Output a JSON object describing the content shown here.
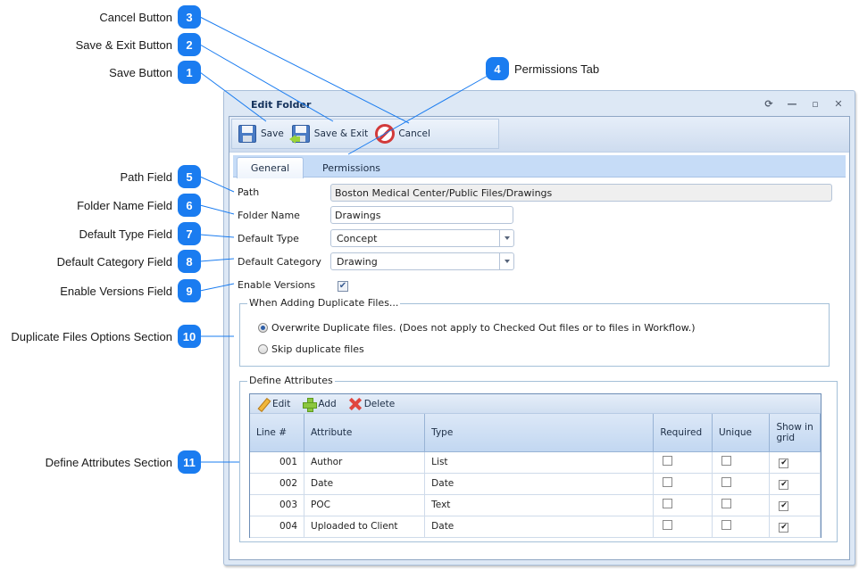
{
  "callouts": [
    {
      "n": "3",
      "label": "Cancel Button"
    },
    {
      "n": "2",
      "label": "Save & Exit Button"
    },
    {
      "n": "1",
      "label": "Save Button"
    },
    {
      "n": "4",
      "label": "Permissions Tab"
    },
    {
      "n": "5",
      "label": "Path Field"
    },
    {
      "n": "6",
      "label": "Folder Name Field"
    },
    {
      "n": "7",
      "label": "Default Type Field"
    },
    {
      "n": "8",
      "label": "Default Category Field"
    },
    {
      "n": "9",
      "label": "Enable Versions Field"
    },
    {
      "n": "10",
      "label": "Duplicate Files Options Section"
    },
    {
      "n": "11",
      "label": "Define Attributes Section"
    }
  ],
  "window": {
    "title": "Edit Folder",
    "controls": {
      "refresh": "⟳",
      "minimize": "—",
      "maximize": "▫",
      "close": "✕"
    }
  },
  "toolbar": {
    "save": "Save",
    "save_exit": "Save & Exit",
    "cancel": "Cancel"
  },
  "tabs": [
    {
      "label": "General",
      "active": true
    },
    {
      "label": "Permissions",
      "active": false
    }
  ],
  "form": {
    "path_label": "Path",
    "path_value": "Boston Medical Center/Public Files/Drawings",
    "folder_name_label": "Folder Name",
    "folder_name_value": "Drawings",
    "default_type_label": "Default Type",
    "default_type_value": "Concept",
    "default_category_label": "Default Category",
    "default_category_value": "Drawing",
    "enable_versions_label": "Enable Versions",
    "enable_versions_checked": true,
    "check_glyph": "✔"
  },
  "duplicates": {
    "legend": "When Adding Duplicate Files...",
    "options": [
      {
        "label": "Overwrite Duplicate files. (Does not apply to Checked Out files or to files in Workflow.)",
        "checked": true
      },
      {
        "label": "Skip duplicate files",
        "checked": false
      }
    ]
  },
  "attributes": {
    "legend": "Define Attributes",
    "toolbar": {
      "edit": "Edit",
      "add": "Add",
      "delete": "Delete"
    },
    "columns": [
      "Line #",
      "Attribute",
      "Type",
      "Required",
      "Unique",
      "Show in grid"
    ],
    "rows": [
      {
        "line": "001",
        "attribute": "Author",
        "type": "List",
        "required": false,
        "unique": false,
        "show": true
      },
      {
        "line": "002",
        "attribute": "Date",
        "type": "Date",
        "required": false,
        "unique": false,
        "show": true
      },
      {
        "line": "003",
        "attribute": "POC",
        "type": "Text",
        "required": false,
        "unique": false,
        "show": true
      },
      {
        "line": "004",
        "attribute": "Uploaded to Client",
        "type": "Date",
        "required": false,
        "unique": false,
        "show": true
      }
    ]
  },
  "colors": {
    "badge": "#1a7cf0",
    "leader_line": "#1a7cf0",
    "title_text": "#15325c"
  }
}
